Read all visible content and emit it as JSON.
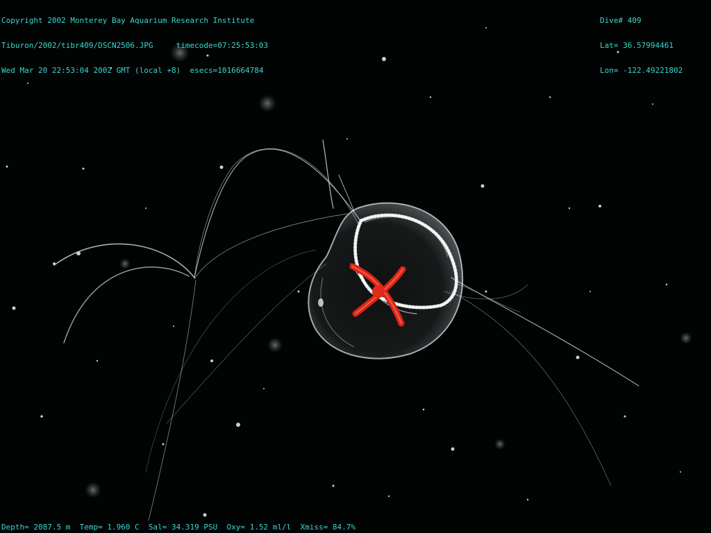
{
  "overlay": {
    "copyright": "Copyright 2002 Monterey Bay Aquarium Research Institute",
    "file_line": "Tiburon/2002/tibr409/DSCN2506.JPG     timecode=07:25:53:03",
    "date_line": "Wed Mar 20 22:53:04 2002 GMT (local +8)  esecs=1016664784",
    "dive": "Dive# 409",
    "lat": "Lat= 36.57994461",
    "lon": "Lon= -122.49221802",
    "bottom_line": "Depth= 2087.5 m  Temp= 1.960 C  Sal= 34.319 PSU  Oxy= 1.52 ml/l  Xmiss= 84.7%"
  },
  "colors": {
    "background": "#020303",
    "overlay_text": "#38d8d0",
    "jelly_bell": "#d8e4ea",
    "radial_canals": "#e02a1c"
  }
}
